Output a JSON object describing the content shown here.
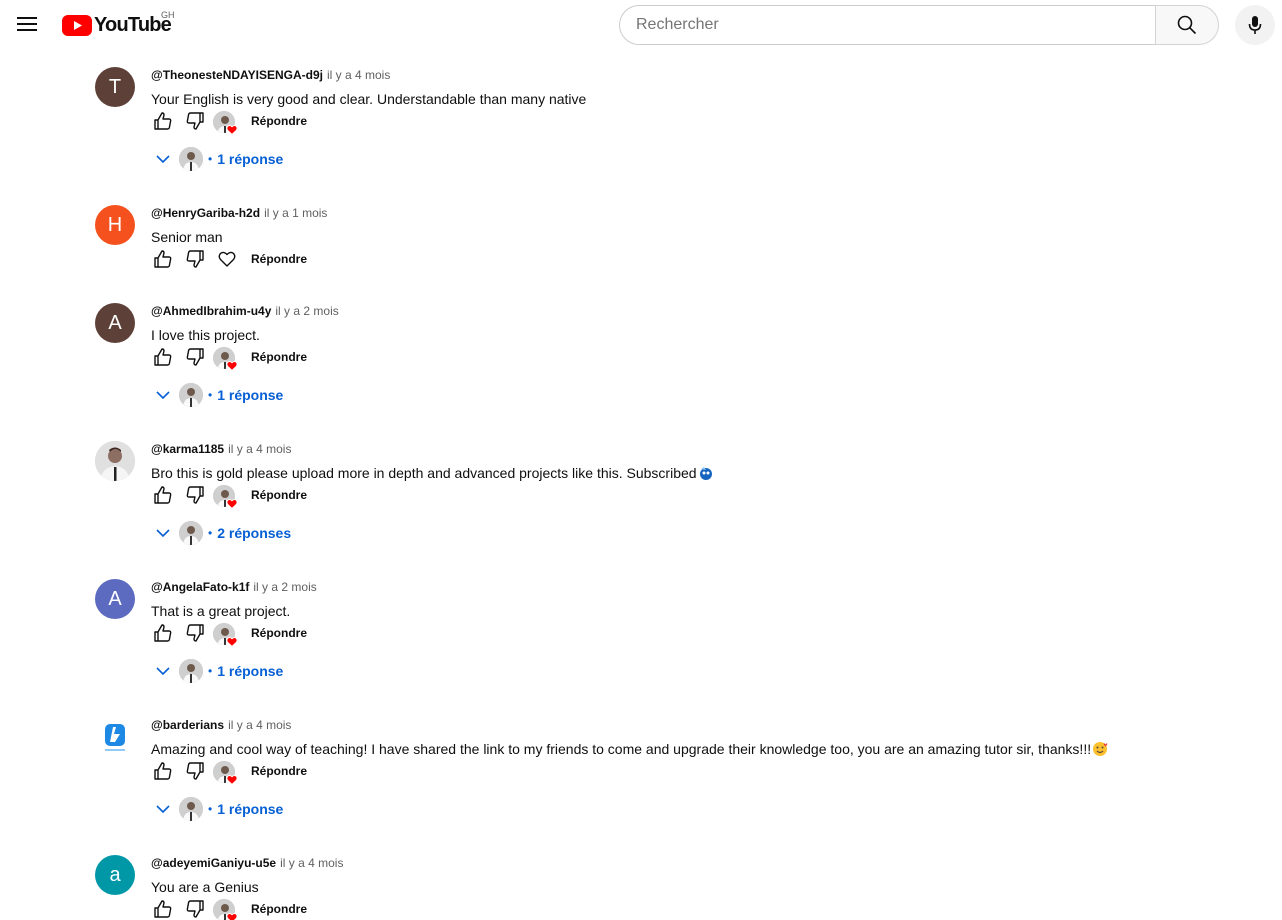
{
  "header": {
    "logo_text": "YouTube",
    "country_code": "GH",
    "search_placeholder": "Rechercher",
    "menu_icon": "hamburger-menu-icon",
    "search_icon": "search-icon",
    "mic_icon": "microphone-icon"
  },
  "labels": {
    "reply": "Répondre"
  },
  "comments": [
    {
      "author": "@TheonesteNDAYISENGA-d9j",
      "time": "il y a 4 mois",
      "text": "Your English is very good and clear. Understandable than many native",
      "avatar_letter": "T",
      "avatar_color": "#5d4037",
      "creator_heart": true,
      "replies": "1 réponse"
    },
    {
      "author": "@HenryGariba-h2d",
      "time": "il y a 1 mois",
      "text": "Senior man",
      "avatar_letter": "H",
      "avatar_color": "#f4511e",
      "creator_heart": false,
      "replies": ""
    },
    {
      "author": "@AhmedIbrahim-u4y",
      "time": "il y a 2 mois",
      "text": "I love this project.",
      "avatar_letter": "A",
      "avatar_color": "#5d4037",
      "creator_heart": true,
      "replies": "1 réponse"
    },
    {
      "author": "@karma1185",
      "time": "il y a 4 mois",
      "text": "Bro this is gold please upload more in depth and advanced projects like this.  Subscribed",
      "avatar_letter": "",
      "avatar_color": "#d7ccc8",
      "creator_heart": true,
      "replies": "2 réponses"
    },
    {
      "author": "@AngelaFato-k1f",
      "time": "il y a 2 mois",
      "text": "That is a great project.",
      "avatar_letter": "A",
      "avatar_color": "#5c6bc0",
      "creator_heart": true,
      "replies": "1 réponse"
    },
    {
      "author": "@barderians",
      "time": "il y a 4 mois",
      "text": "Amazing and cool way of teaching! I have shared the link to my friends to come and upgrade their knowledge too, you are an amazing tutor sir, thanks!!!",
      "avatar_letter": "",
      "avatar_color": "#ffffff",
      "creator_heart": true,
      "replies": "1 réponse"
    },
    {
      "author": "@adeyemiGaniyu-u5e",
      "time": "il y a 4 mois",
      "text": "You are a Genius",
      "avatar_letter": "a",
      "avatar_color": "#0097a7",
      "creator_heart": true,
      "replies": ""
    }
  ]
}
